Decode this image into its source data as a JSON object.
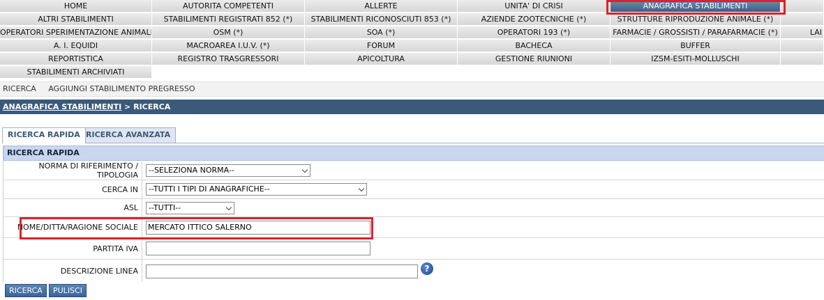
{
  "menu": {
    "home": "HOME",
    "autorita": "AUTORITA COMPETENTI",
    "allerte": "ALLERTE",
    "unita_crisi": "UNITA' DI CRISI",
    "anagrafica": "ANAGRAFICA STABILIMENTI",
    "altri_stabilimenti": "ALTRI STABILIMENTI",
    "registrati_852": "STABILIMENTI REGISTRATI 852 (*)",
    "riconosciuti_853": "STABILIMENTI RICONOSCIUTI 853 (*)",
    "aziende_zootecniche": "AZIENDE ZOOTECNICHE (*)",
    "strutture_riproduzione": "STRUTTURE RIPRODUZIONE ANIMALE (*)",
    "operatori_sperimentazione": "OPERATORI SPERIMENTAZIONE ANIMALE",
    "osm": "OSM (*)",
    "soa": "SOA (*)",
    "operatori_193": "OPERATORI 193 (*)",
    "farmacie": "FARMACIE / GROSSISTI / PARAFARMACIE (*)",
    "lab_partial": "LAI",
    "ai_equidi": "A. I. EQUIDI",
    "macroarea": "MACROAREA I.U.V. (*)",
    "forum": "FORUM",
    "bacheca": "BACHECA",
    "buffer": "BUFFER",
    "reportistica": "REPORTISTICA",
    "registro_trasgressori": "REGISTRO TRASGRESSORI",
    "apicoltura": "APICOLTURA",
    "gestione_riunioni": "GESTIONE RIUNIONI",
    "izsm": "IZSM-ESITI-MOLLUSCHI",
    "archiviati": "STABILIMENTI ARCHIVIATI"
  },
  "submenu": {
    "ricerca": "RICERCA",
    "aggiungi": "AGGIUNGI STABILIMENTO PREGRESSO"
  },
  "breadcrumb": {
    "link": "ANAGRAFICA STABILIMENTI",
    "separator": " > ",
    "current": "RICERCA"
  },
  "tabs": {
    "rapida": "RICERCA RAPIDA",
    "avanzata": "RICERCA AVANZATA"
  },
  "form": {
    "header": "RICERCA RAPIDA",
    "norma_label": "NORMA DI RIFERIMENTO / TIPOLOGIA",
    "norma_value": "--SELEZIONA NORMA--",
    "cerca_in_label": "CERCA IN",
    "cerca_in_value": "--TUTTI I TIPI DI ANAGRAFICHE--",
    "asl_label": "ASL",
    "asl_value": "--TUTTI--",
    "nome_label": "NOME/DITTA/RAGIONE SOCIALE",
    "nome_value": "MERCATO ITTICO SALERNO",
    "partita_iva_label": "PARTITA IVA",
    "partita_iva_value": "",
    "descrizione_label": "DESCRIZIONE LINEA",
    "descrizione_value": "",
    "help_glyph": "?"
  },
  "buttons": {
    "ricerca": "RICERCA",
    "pulisci": "PULISCI"
  },
  "colors": {
    "title_bar": "#3b5a7a",
    "active_menu": "#3e5e82",
    "form_header": "#c8d7f0",
    "highlight": "#e0202a",
    "button": "#3a6396"
  }
}
